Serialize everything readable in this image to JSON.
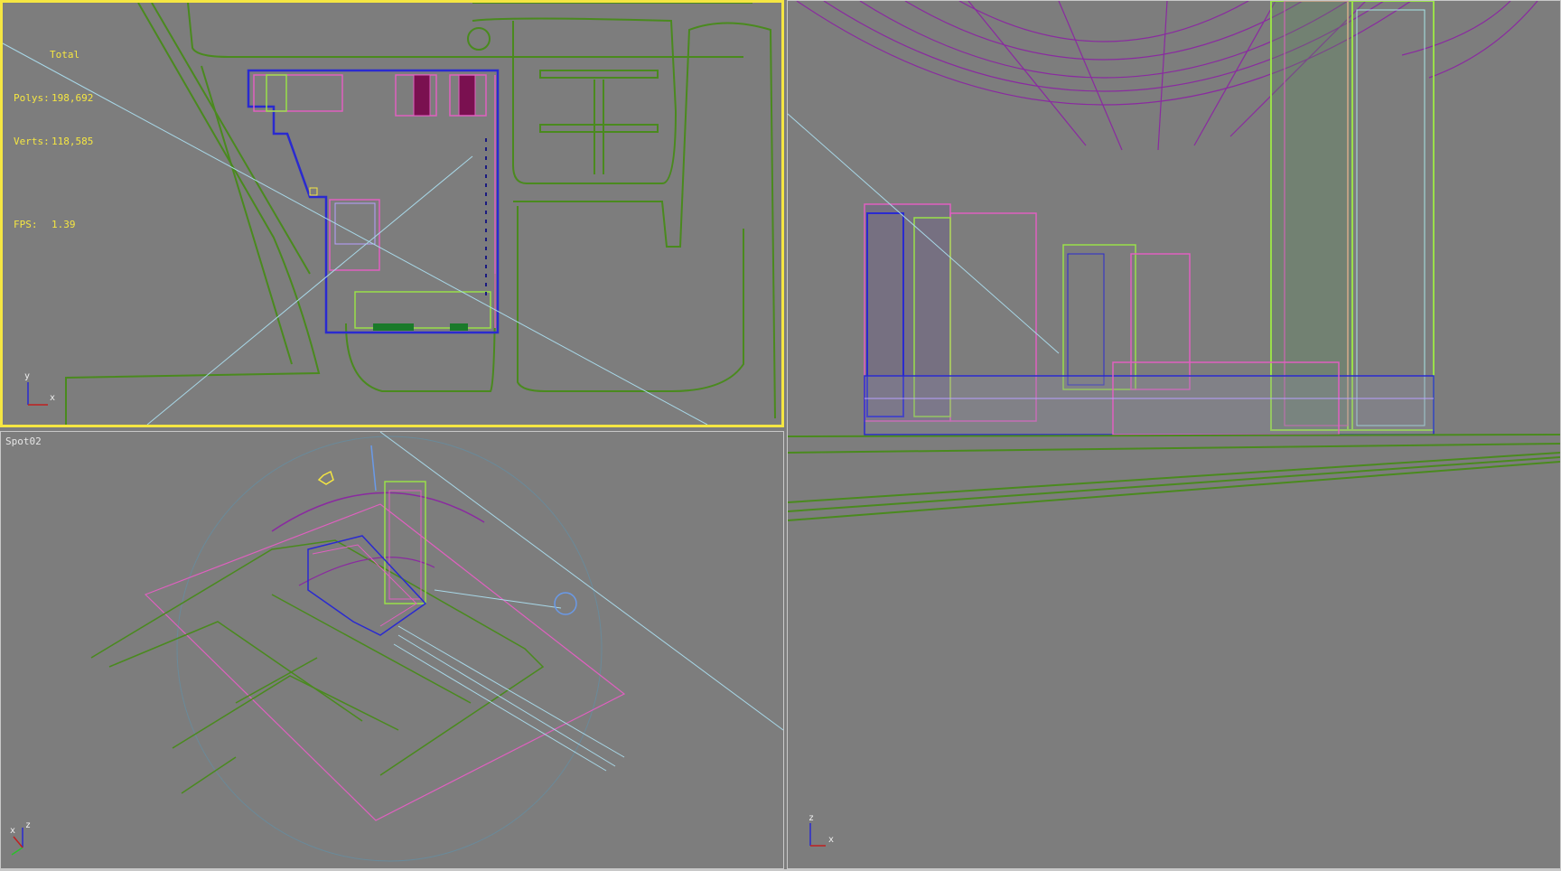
{
  "viewport_top": {
    "stats_header": "Total",
    "polys_label": "Polys:",
    "polys_value": "198,692",
    "verts_label": "Verts:",
    "verts_value": "118,585",
    "fps_label": "FPS:",
    "fps_value": "1.39",
    "axis_y": "y",
    "axis_x": "x"
  },
  "viewport_spot": {
    "label": "Spot02",
    "axis_z": "z",
    "axis_x": "x"
  },
  "viewport_persp": {
    "axis_z": "z",
    "axis_x": "x"
  },
  "colors": {
    "active_border": "#f5e642",
    "road": "#4a8a1e",
    "building_blue": "#2a2ad0",
    "building_pink": "#e060c0",
    "building_green": "#9ae04a",
    "dome": "#8a2aa0",
    "light_line": "#a8d8e8"
  }
}
